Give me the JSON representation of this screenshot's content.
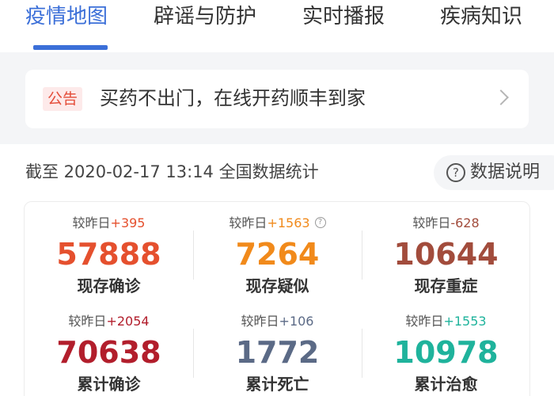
{
  "tabs": [
    {
      "label": "疫情地图",
      "active": true
    },
    {
      "label": "辟谣与防护",
      "active": false
    },
    {
      "label": "实时播报",
      "active": false
    },
    {
      "label": "疾病知识",
      "active": false
    }
  ],
  "notice": {
    "badge": "公告",
    "text": "买药不出门，在线开药顺丰到家",
    "icon": "chevron-right-icon"
  },
  "stats": {
    "as_of": "截至 2020-02-17 13:14 全国数据统计",
    "help_label": "数据说明",
    "help_icon": "question-circle-icon",
    "delta_prefix": "较昨日",
    "items": [
      {
        "label": "现存确诊",
        "value": "57888",
        "delta": "+395",
        "color": "#e5502e",
        "delta_color": "#e5502e"
      },
      {
        "label": "现存疑似",
        "value": "7264",
        "delta": "+1563",
        "color": "#f18a1b",
        "delta_color": "#f18a1b",
        "has_info": true
      },
      {
        "label": "现存重症",
        "value": "10644",
        "delta": "-628",
        "color": "#a24c3c",
        "delta_color": "#a24c3c"
      },
      {
        "label": "累计确诊",
        "value": "70638",
        "delta": "+2054",
        "color": "#b21e2c",
        "delta_color": "#b21e2c"
      },
      {
        "label": "累计死亡",
        "value": "1772",
        "delta": "+106",
        "color": "#5b6a86",
        "delta_color": "#5b6a86"
      },
      {
        "label": "累计治愈",
        "value": "10978",
        "delta": "+1553",
        "color": "#1fb39c",
        "delta_color": "#1fb39c"
      }
    ]
  }
}
